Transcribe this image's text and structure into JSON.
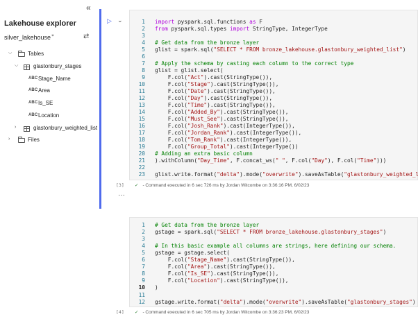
{
  "explorer": {
    "collapse_glyph": "«",
    "title": "Lakehouse explorer",
    "lakehouse": "silver_lakehouse",
    "pin_glyph": "📌",
    "swap_glyph": "⇄",
    "tables_label": "Tables",
    "table1": "glastonbury_stages",
    "columns": [
      "Stage_Name",
      "Area",
      "Is_SE",
      "Location"
    ],
    "column_type": "ABC",
    "table2": "glastonbury_weighted_list",
    "files_label": "Files"
  },
  "cell1": {
    "number": "[3]",
    "status": "- Command executed in 6 sec 726 ms by Jordan Witcombe on 3:36:16 PM, 6/02/23",
    "lines": [
      {
        "n": "1",
        "code": "<span class=\"kw\">import</span> pyspark.sql.functions <span class=\"kw\">as</span> F"
      },
      {
        "n": "2",
        "code": "<span class=\"kw\">from</span> pyspark.sql.types <span class=\"kw\">import</span> StringType, IntegerType"
      },
      {
        "n": "3",
        "code": ""
      },
      {
        "n": "4",
        "code": "<span class=\"cm\"># Get data from the bronze layer</span>"
      },
      {
        "n": "5",
        "code": "glist = spark.sql(<span class=\"st\">\"SELECT * FROM bronze_lakehouse.glastonbury_weighted_list\"</span>)"
      },
      {
        "n": "6",
        "code": ""
      },
      {
        "n": "7",
        "code": "<span class=\"cm\"># Apply the schema by casting each column to the correct type</span>"
      },
      {
        "n": "8",
        "code": "glist = glist.select("
      },
      {
        "n": "9",
        "code": "    F.col(<span class=\"st\">\"Act\"</span>).cast(StringType()),"
      },
      {
        "n": "10",
        "code": "    F.col(<span class=\"st\">\"Stage\"</span>).cast(StringType()),"
      },
      {
        "n": "11",
        "code": "    F.col(<span class=\"st\">\"Date\"</span>).cast(StringType()),"
      },
      {
        "n": "12",
        "code": "    F.col(<span class=\"st\">\"Day\"</span>).cast(StringType()),"
      },
      {
        "n": "13",
        "code": "    F.col(<span class=\"st\">\"Time\"</span>).cast(StringType()),"
      },
      {
        "n": "14",
        "code": "    F.col(<span class=\"st\">\"Added_By\"</span>).cast(StringType()),"
      },
      {
        "n": "15",
        "code": "    F.col(<span class=\"st\">\"Must_See\"</span>).cast(StringType()),"
      },
      {
        "n": "16",
        "code": "    F.col(<span class=\"st\">\"Josh_Rank\"</span>).cast(IntegerType()),"
      },
      {
        "n": "17",
        "code": "    F.col(<span class=\"st\">\"Jordan_Rank\"</span>).cast(IntegerType()),"
      },
      {
        "n": "18",
        "code": "    F.col(<span class=\"st\">\"Tom_Rank\"</span>).cast(IntegerType()),"
      },
      {
        "n": "19",
        "code": "    F.col(<span class=\"st\">\"Group_Total\"</span>).cast(IntegerType())"
      },
      {
        "n": "20",
        "code": "<span class=\"cm\"># Adding an extra basic column</span>"
      },
      {
        "n": "21",
        "code": ").withColumn(<span class=\"st\">\"Day_Time\"</span>, F.concat_ws(<span class=\"st\">\" \"</span>, F.col(<span class=\"st\">\"Day\"</span>), F.col(<span class=\"st\">\"Time\"</span>)))"
      },
      {
        "n": "22",
        "code": ""
      },
      {
        "n": "23",
        "code": "glist.write.format(<span class=\"st\">\"delta\"</span>).mode(<span class=\"st\">\"overwrite\"</span>).saveAsTable(<span class=\"st\">\"glastonbury_weighted_list\"</span>)"
      }
    ]
  },
  "cell2": {
    "number": "[4]",
    "status": "- Command executed in 6 sec 705 ms by Jordan Witcombe on 3:36:23 PM, 6/02/23",
    "lines": [
      {
        "n": "1",
        "code": "<span class=\"cm\"># Get data from the bronze layer</span>"
      },
      {
        "n": "2",
        "code": "gstage = spark.sql(<span class=\"st\">\"SELECT * FROM bronze_lakehouse.glastonbury_stages\"</span>)"
      },
      {
        "n": "3",
        "code": ""
      },
      {
        "n": "4",
        "code": "<span class=\"cm\"># In this basic example all columns are strings, here defining our schema.</span>"
      },
      {
        "n": "5",
        "code": "gstage = gstage.select("
      },
      {
        "n": "6",
        "code": "    F.col(<span class=\"st\">\"Stage_Name\"</span>).cast(StringType()),"
      },
      {
        "n": "7",
        "code": "    F.col(<span class=\"st\">\"Area\"</span>).cast(StringType()),"
      },
      {
        "n": "8",
        "code": "    F.col(<span class=\"st\">\"Is_SE\"</span>).cast(StringType()),"
      },
      {
        "n": "9",
        "code": "    F.col(<span class=\"st\">\"Location\"</span>).cast(StringType()),"
      },
      {
        "n": "10",
        "code": ")"
      },
      {
        "n": "11",
        "code": ""
      },
      {
        "n": "12",
        "code": "gstage.write.format(<span class=\"st\">\"delta\"</span>).mode(<span class=\"st\">\"overwrite\"</span>).saveAsTable(<span class=\"st\">\"glastonbury_stages\"</span>)"
      }
    ]
  },
  "notebook": {
    "more_glyph": "···",
    "run_glyph": "▷",
    "chevron_glyph": "⌄",
    "check_glyph": "✓"
  },
  "colors": {
    "accent": "#4f6bed",
    "keyword": "#af00db",
    "comment": "#008000",
    "string": "#a31515",
    "line_number": "#237893"
  }
}
